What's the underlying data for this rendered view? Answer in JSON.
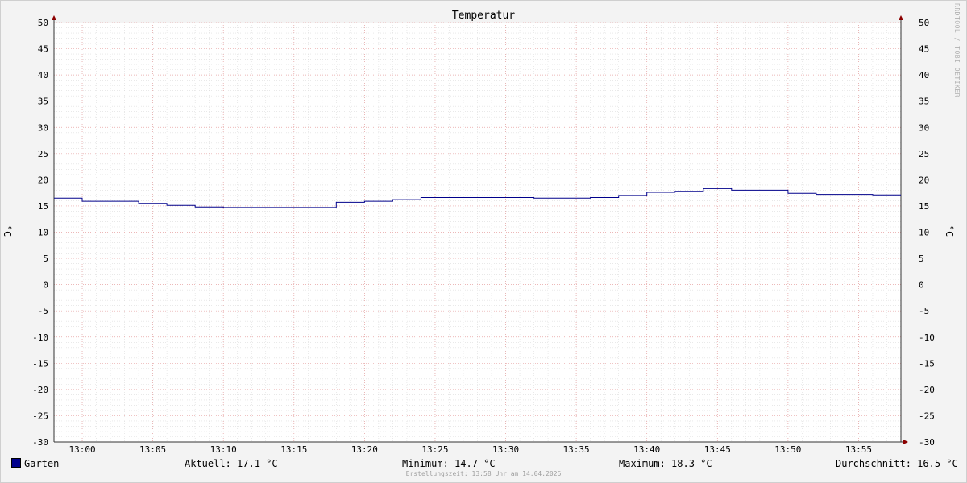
{
  "chart_data": {
    "type": "line",
    "title": "Temperatur",
    "ylabel": "°C",
    "ylim": [
      -30,
      50
    ],
    "yticks": [
      50,
      45,
      40,
      35,
      30,
      25,
      20,
      15,
      10,
      5,
      0,
      -5,
      -10,
      -15,
      -20,
      -25,
      -30
    ],
    "xlim": [
      "12:58",
      "13:58"
    ],
    "xticks": [
      "13:00",
      "13:05",
      "13:10",
      "13:15",
      "13:20",
      "13:25",
      "13:30",
      "13:35",
      "13:40",
      "13:45",
      "13:50",
      "13:55"
    ],
    "grid": true,
    "step": true,
    "legend_position": "bottom-left",
    "series": [
      {
        "name": "Garten",
        "color": "#00008b",
        "x": [
          "12:58",
          "13:00",
          "13:04",
          "13:06",
          "13:08",
          "13:10",
          "13:12",
          "13:14",
          "13:16",
          "13:18",
          "13:20",
          "13:22",
          "13:24",
          "13:26",
          "13:28",
          "13:30",
          "13:32",
          "13:34",
          "13:36",
          "13:38",
          "13:40",
          "13:42",
          "13:44",
          "13:46",
          "13:48",
          "13:50",
          "13:52",
          "13:54",
          "13:56",
          "13:58"
        ],
        "y": [
          16.5,
          15.9,
          15.5,
          15.1,
          14.8,
          14.7,
          14.7,
          14.7,
          14.7,
          15.7,
          15.9,
          16.2,
          16.6,
          16.6,
          16.6,
          16.6,
          16.5,
          16.5,
          16.6,
          17.0,
          17.6,
          17.8,
          18.3,
          18.0,
          18.0,
          17.4,
          17.2,
          17.2,
          17.1,
          17.1
        ]
      }
    ]
  },
  "legend": {
    "series_name": "Garten",
    "aktuell": "Aktuell: 17.1 °C",
    "minimum": "Minimum: 14.7 °C",
    "maximum": "Maximum: 18.3 °C",
    "durchschnitt": "Durchschnitt: 16.5 °C"
  },
  "watermark": "RRDTOOL / TOBI OETIKER",
  "footer": "Erstellungszeit: 13:58 Uhr am 14.04.2026"
}
